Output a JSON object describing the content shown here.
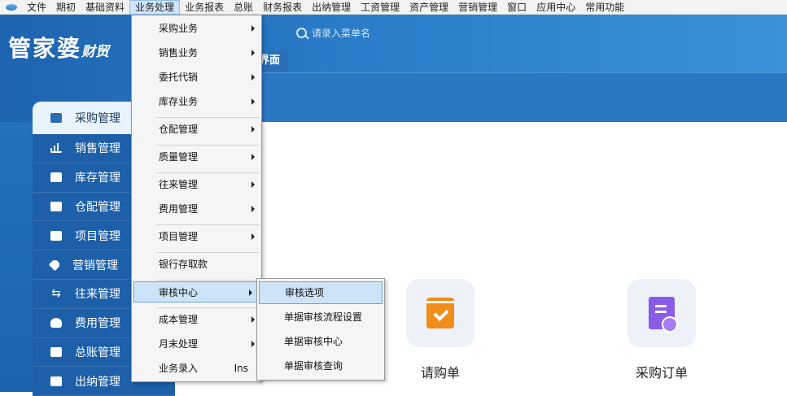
{
  "menubar": {
    "items": [
      "文件",
      "期初",
      "基础资料",
      "业务处理",
      "业务报表",
      "总账",
      "财务报表",
      "出纳管理",
      "工资管理",
      "资产管理",
      "营销管理",
      "窗口",
      "应用中心",
      "常用功能"
    ],
    "active_index": 3
  },
  "header": {
    "logo_main": "管家婆",
    "logo_sub": "财贸",
    "search_placeholder": "请录入菜单名",
    "home_tab_label": "界面"
  },
  "sidebar": {
    "items": [
      {
        "label": "采购管理",
        "icon": "basket-icon"
      },
      {
        "label": "销售管理",
        "icon": "bar-chart-icon"
      },
      {
        "label": "库存管理",
        "icon": "cart-icon"
      },
      {
        "label": "仓配管理",
        "icon": "box-icon"
      },
      {
        "label": "项目管理",
        "icon": "folder-icon"
      },
      {
        "label": "营销管理",
        "icon": "tag-icon"
      },
      {
        "label": "往来管理",
        "icon": "swap-icon"
      },
      {
        "label": "费用管理",
        "icon": "money-bag-icon"
      },
      {
        "label": "总账管理",
        "icon": "wallet-icon"
      },
      {
        "label": "出纳管理",
        "icon": "cashier-icon"
      }
    ]
  },
  "dropdown": {
    "items": [
      {
        "label": "采购业务",
        "arrow": true
      },
      {
        "label": "销售业务",
        "arrow": true
      },
      {
        "label": "委托代销",
        "arrow": true
      },
      {
        "label": "库存业务",
        "arrow": true
      },
      {
        "label": "仓配管理",
        "arrow": true
      },
      {
        "label": "质量管理",
        "arrow": true
      },
      {
        "label": "往来管理",
        "arrow": true
      },
      {
        "label": "费用管理",
        "arrow": true
      },
      {
        "label": "项目管理",
        "arrow": true
      },
      {
        "label": "银行存取款",
        "arrow": false
      },
      {
        "label": "审核中心",
        "arrow": true
      },
      {
        "label": "成本管理",
        "arrow": true
      },
      {
        "label": "月末处理",
        "arrow": true
      },
      {
        "label": "业务录入",
        "arrow": false,
        "shortcut": "Ins"
      }
    ],
    "highlighted": "审核中心"
  },
  "submenu": {
    "items": [
      "审核选项",
      "单据审核流程设置",
      "单据审核中心",
      "单据审核查询"
    ],
    "highlighted": "审核选项"
  },
  "cards": [
    {
      "label": "请购单",
      "icon": "requisition-icon",
      "color": "#f28c1b"
    },
    {
      "label": "采购订单",
      "icon": "purchase-order-icon",
      "color": "#8a5ae8"
    }
  ]
}
